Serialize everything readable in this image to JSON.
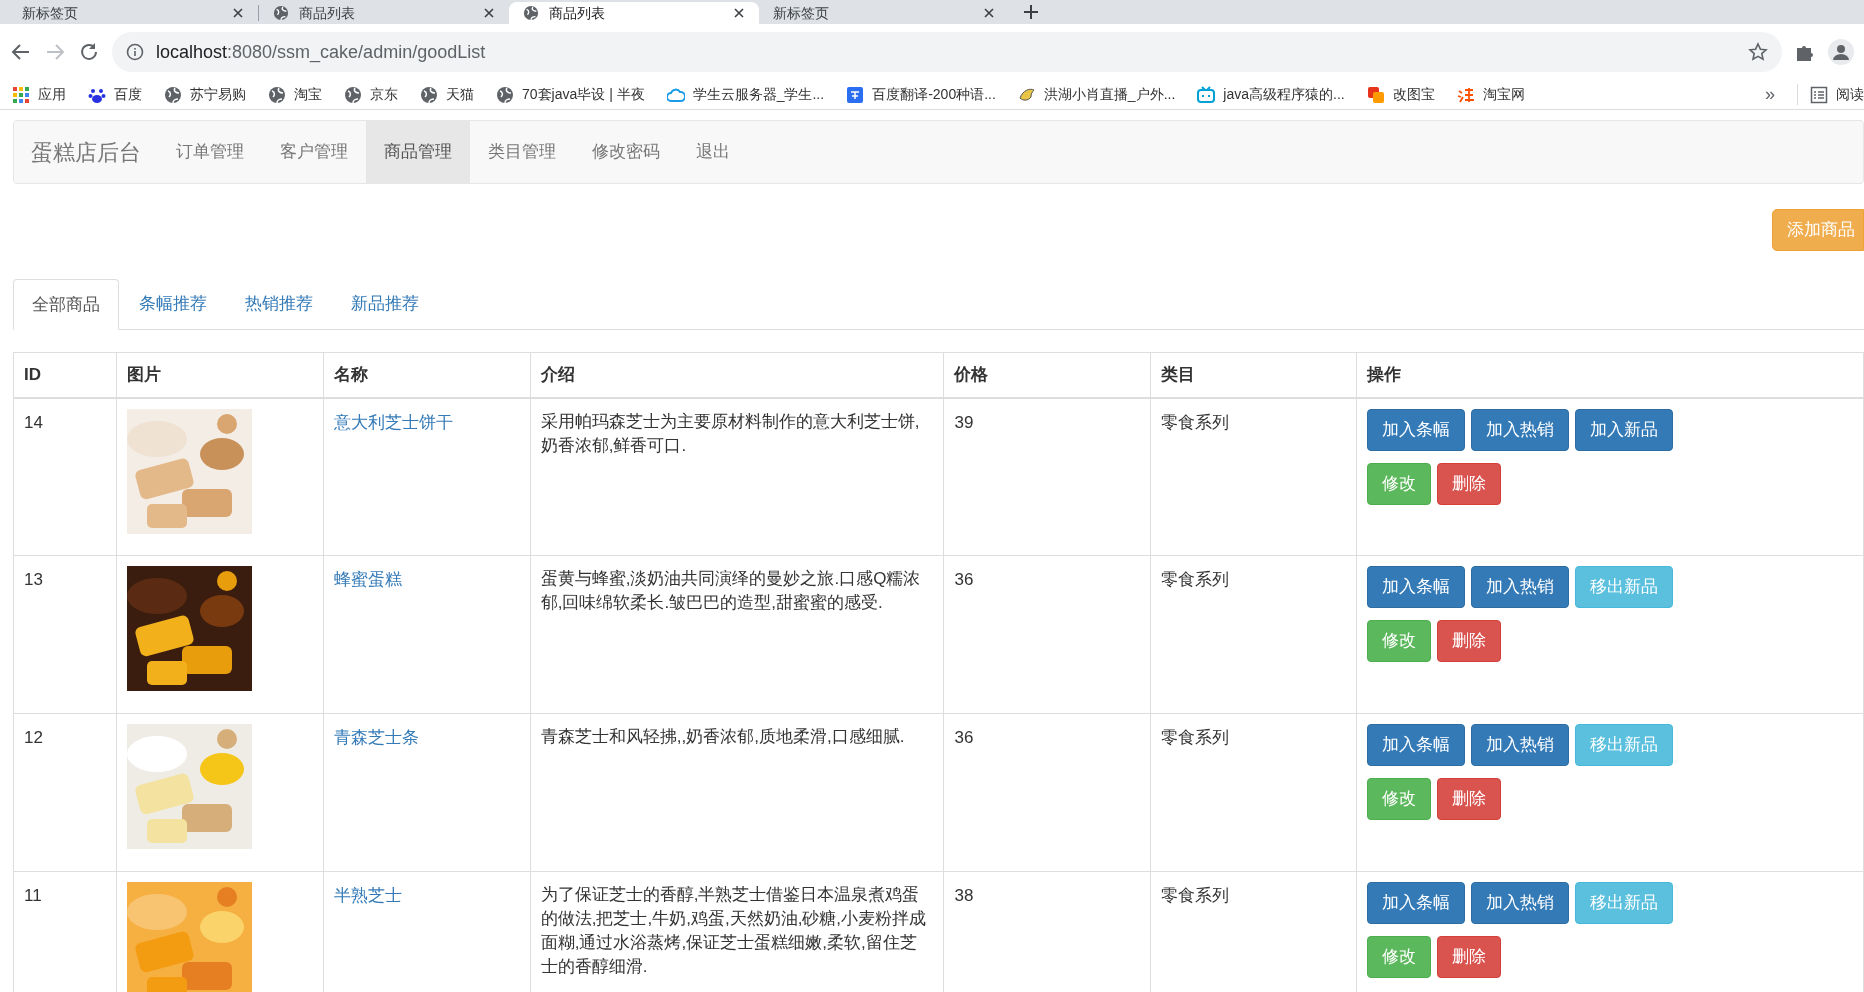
{
  "browser_tabs": [
    {
      "title": "新标签页",
      "selected": false
    },
    {
      "title": "商品列表",
      "selected": false
    },
    {
      "title": "商品列表",
      "selected": true
    },
    {
      "title": "新标签页",
      "selected": false
    }
  ],
  "address_bar": {
    "host": "localhost",
    "rest": ":8080/ssm_cake/admin/goodList"
  },
  "bookmarks": [
    {
      "label": "应用"
    },
    {
      "label": "百度"
    },
    {
      "label": "苏宁易购"
    },
    {
      "label": "淘宝"
    },
    {
      "label": "京东"
    },
    {
      "label": "天猫"
    },
    {
      "label": "70套java毕设 | 半夜"
    },
    {
      "label": "学生云服务器_学生..."
    },
    {
      "label": "百度翻译-200种语..."
    },
    {
      "label": "洪湖小肖直播_户外..."
    },
    {
      "label": "java高级程序猿的..."
    },
    {
      "label": "改图宝"
    },
    {
      "label": "淘宝网"
    }
  ],
  "bookmarks_more": "»",
  "reading_list": "阅读",
  "navbar": {
    "brand": "蛋糕店后台",
    "items": [
      {
        "label": "订单管理",
        "selected": false
      },
      {
        "label": "客户管理",
        "selected": false
      },
      {
        "label": "商品管理",
        "selected": true
      },
      {
        "label": "类目管理",
        "selected": false
      },
      {
        "label": "修改密码",
        "selected": false
      },
      {
        "label": "退出",
        "selected": false
      }
    ]
  },
  "add_button": "添加商品",
  "tabs": [
    {
      "label": "全部商品",
      "selected": true
    },
    {
      "label": "条幅推荐",
      "selected": false
    },
    {
      "label": "热销推荐",
      "selected": false
    },
    {
      "label": "新品推荐",
      "selected": false
    }
  ],
  "table": {
    "columns": [
      "ID",
      "图片",
      "名称",
      "介绍",
      "价格",
      "类目",
      "操作"
    ],
    "rows": [
      {
        "id": "14",
        "name": "意大利芝士饼干",
        "intro": "采用帕玛森芝士为主要原材料制作的意大利芝士饼,奶香浓郁,鲜香可口.",
        "price": "39",
        "category": "零食系列",
        "actions": [
          [
            {
              "label": "加入条幅",
              "kind": "primary"
            },
            {
              "label": "加入热销",
              "kind": "primary"
            },
            {
              "label": "加入新品",
              "kind": "primary"
            }
          ],
          [
            {
              "label": "修改",
              "kind": "success"
            },
            {
              "label": "删除",
              "kind": "danger"
            }
          ]
        ]
      },
      {
        "id": "13",
        "name": "蜂蜜蛋糕",
        "intro": "蛋黄与蜂蜜,淡奶油共同演绎的曼妙之旅.口感Q糯浓郁,回味绵软柔长.皱巴巴的造型,甜蜜蜜的感受.",
        "price": "36",
        "category": "零食系列",
        "actions": [
          [
            {
              "label": "加入条幅",
              "kind": "primary"
            },
            {
              "label": "加入热销",
              "kind": "primary"
            },
            {
              "label": "移出新品",
              "kind": "info"
            }
          ],
          [
            {
              "label": "修改",
              "kind": "success"
            },
            {
              "label": "删除",
              "kind": "danger"
            }
          ]
        ]
      },
      {
        "id": "12",
        "name": "青森芝士条",
        "intro": "青森芝士和风轻拂,,奶香浓郁,质地柔滑,口感细腻.",
        "price": "36",
        "category": "零食系列",
        "actions": [
          [
            {
              "label": "加入条幅",
              "kind": "primary"
            },
            {
              "label": "加入热销",
              "kind": "primary"
            },
            {
              "label": "移出新品",
              "kind": "info"
            }
          ],
          [
            {
              "label": "修改",
              "kind": "success"
            },
            {
              "label": "删除",
              "kind": "danger"
            }
          ]
        ]
      },
      {
        "id": "11",
        "name": "半熟芝士",
        "intro": "为了保证芝士的香醇,半熟芝士借鉴日本温泉煮鸡蛋的做法,把芝士,牛奶,鸡蛋,天然奶油,砂糖,小麦粉拌成面糊,通过水浴蒸烤,保证芝士蛋糕细嫩,柔软,留住芝士的香醇细滑.",
        "price": "38",
        "category": "零食系列",
        "actions": [
          [
            {
              "label": "加入条幅",
              "kind": "primary"
            },
            {
              "label": "加入热销",
              "kind": "primary"
            },
            {
              "label": "移出新品",
              "kind": "info"
            }
          ],
          [
            {
              "label": "修改",
              "kind": "success"
            },
            {
              "label": "删除",
              "kind": "danger"
            }
          ]
        ]
      }
    ]
  }
}
